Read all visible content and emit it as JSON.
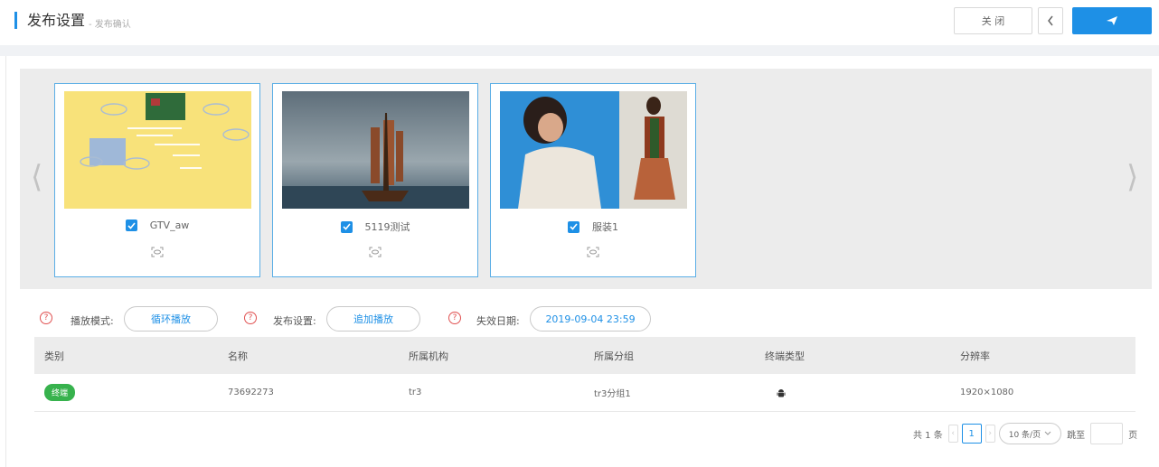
{
  "header": {
    "title": "发布设置",
    "subtitle": "- 发布确认",
    "close_label": "关 闭",
    "back_icon": "chevron-left-icon",
    "send_icon": "send-icon"
  },
  "colors": {
    "accent": "#1e90e6",
    "success": "#37b24d",
    "danger": "#e05050"
  },
  "carousel": {
    "prev_icon": "chevron-left-icon",
    "next_icon": "chevron-right-icon",
    "items": [
      {
        "name": "GTV_aw",
        "checked": true
      },
      {
        "name": "5119测试",
        "checked": true
      },
      {
        "name": "服装1",
        "checked": true
      }
    ]
  },
  "settings": {
    "play_mode_label": "播放模式:",
    "play_mode_value": "循环播放",
    "publish_label": "发布设置:",
    "publish_value": "追加播放",
    "expire_label": "失效日期:",
    "expire_value": "2019-09-04 23:59"
  },
  "table": {
    "columns": [
      "类别",
      "名称",
      "所属机构",
      "所属分组",
      "终端类型",
      "分辨率"
    ],
    "rows": [
      {
        "category": "终端",
        "name": "73692273",
        "org": "tr3",
        "group": "tr3分组1",
        "terminal_type_icon": "android-icon",
        "resolution": "1920×1080"
      }
    ]
  },
  "pagination": {
    "total": "共 1 条",
    "current_page": "1",
    "page_size": "10 条/页",
    "jump_label": "跳至",
    "page_suffix": "页"
  }
}
